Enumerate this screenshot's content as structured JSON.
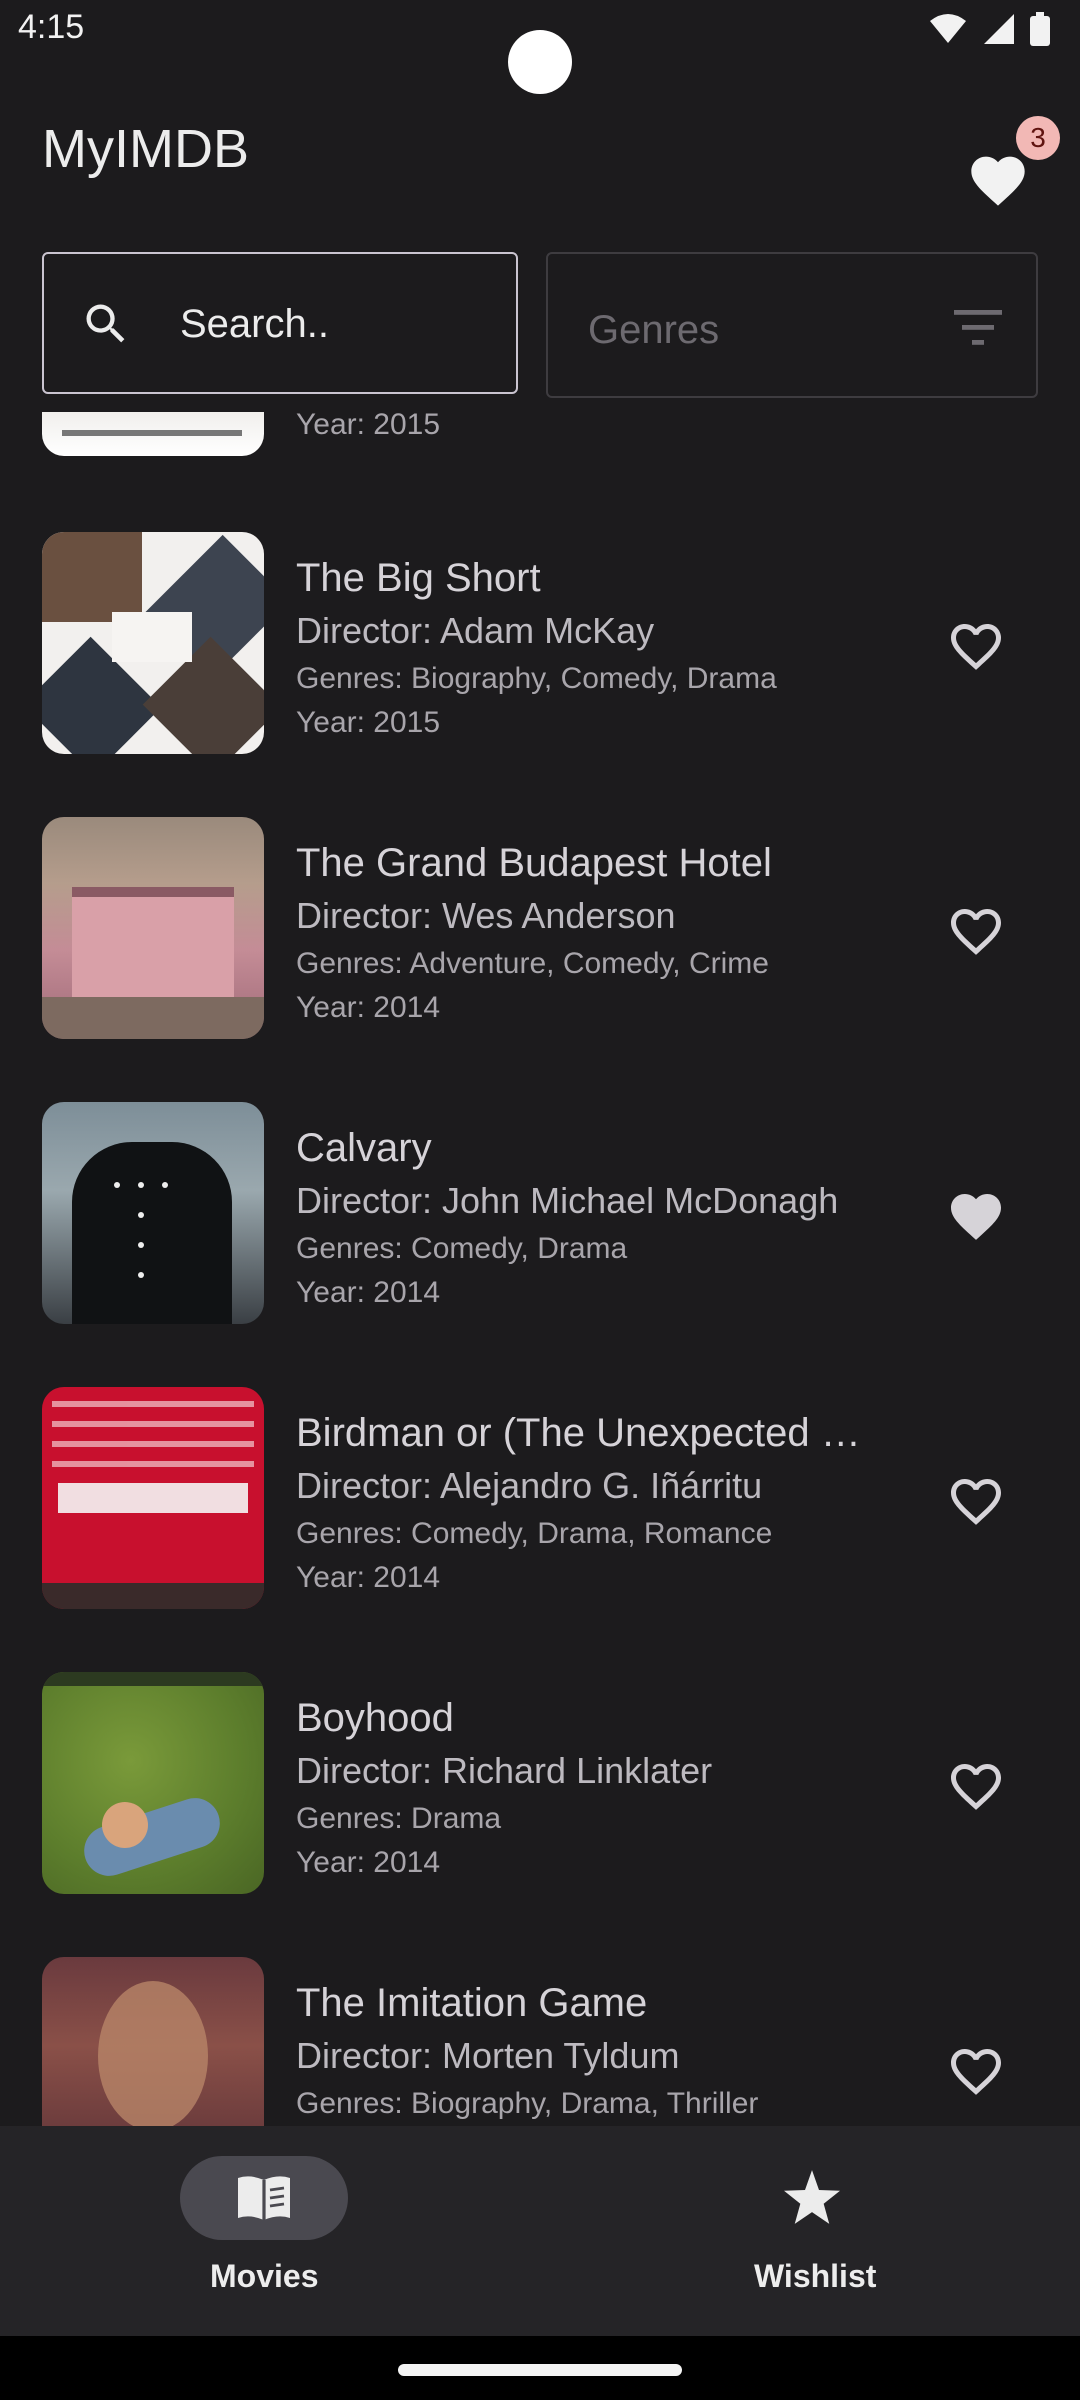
{
  "status_bar": {
    "time": "4:15"
  },
  "app": {
    "title": "MyIMDB",
    "favorites_count": "3"
  },
  "search": {
    "placeholder": "Search.."
  },
  "genre_filter": {
    "label": "Genres"
  },
  "partial_top": {
    "year": "Year: 2015"
  },
  "movies": [
    {
      "title": "The Big Short",
      "director": "Director: Adam McKay",
      "genres": "Genres: Biography, Comedy, Drama",
      "year": "Year: 2015",
      "favorite": false
    },
    {
      "title": "The Grand Budapest Hotel",
      "director": "Director: Wes Anderson",
      "genres": "Genres: Adventure, Comedy, Crime",
      "year": "Year: 2014",
      "favorite": false
    },
    {
      "title": "Calvary",
      "director": "Director: John Michael McDonagh",
      "genres": "Genres: Comedy, Drama",
      "year": "Year: 2014",
      "favorite": true
    },
    {
      "title": "Birdman or (The Unexpected …",
      "director": "Director: Alejandro G. Iñárritu",
      "genres": "Genres: Comedy, Drama, Romance",
      "year": "Year: 2014",
      "favorite": false
    },
    {
      "title": "Boyhood",
      "director": "Director: Richard Linklater",
      "genres": "Genres: Drama",
      "year": "Year: 2014",
      "favorite": false
    },
    {
      "title": "The Imitation Game",
      "director": "Director: Morten Tyldum",
      "genres": "Genres: Biography, Drama, Thriller",
      "year": "",
      "favorite": false
    }
  ],
  "nav": {
    "movies_label": "Movies",
    "wishlist_label": "Wishlist"
  },
  "colors": {
    "background": "#1c1b1d",
    "badge": "#f2b8b5",
    "nav_bg": "#252427",
    "nav_pill": "#4a4950"
  }
}
